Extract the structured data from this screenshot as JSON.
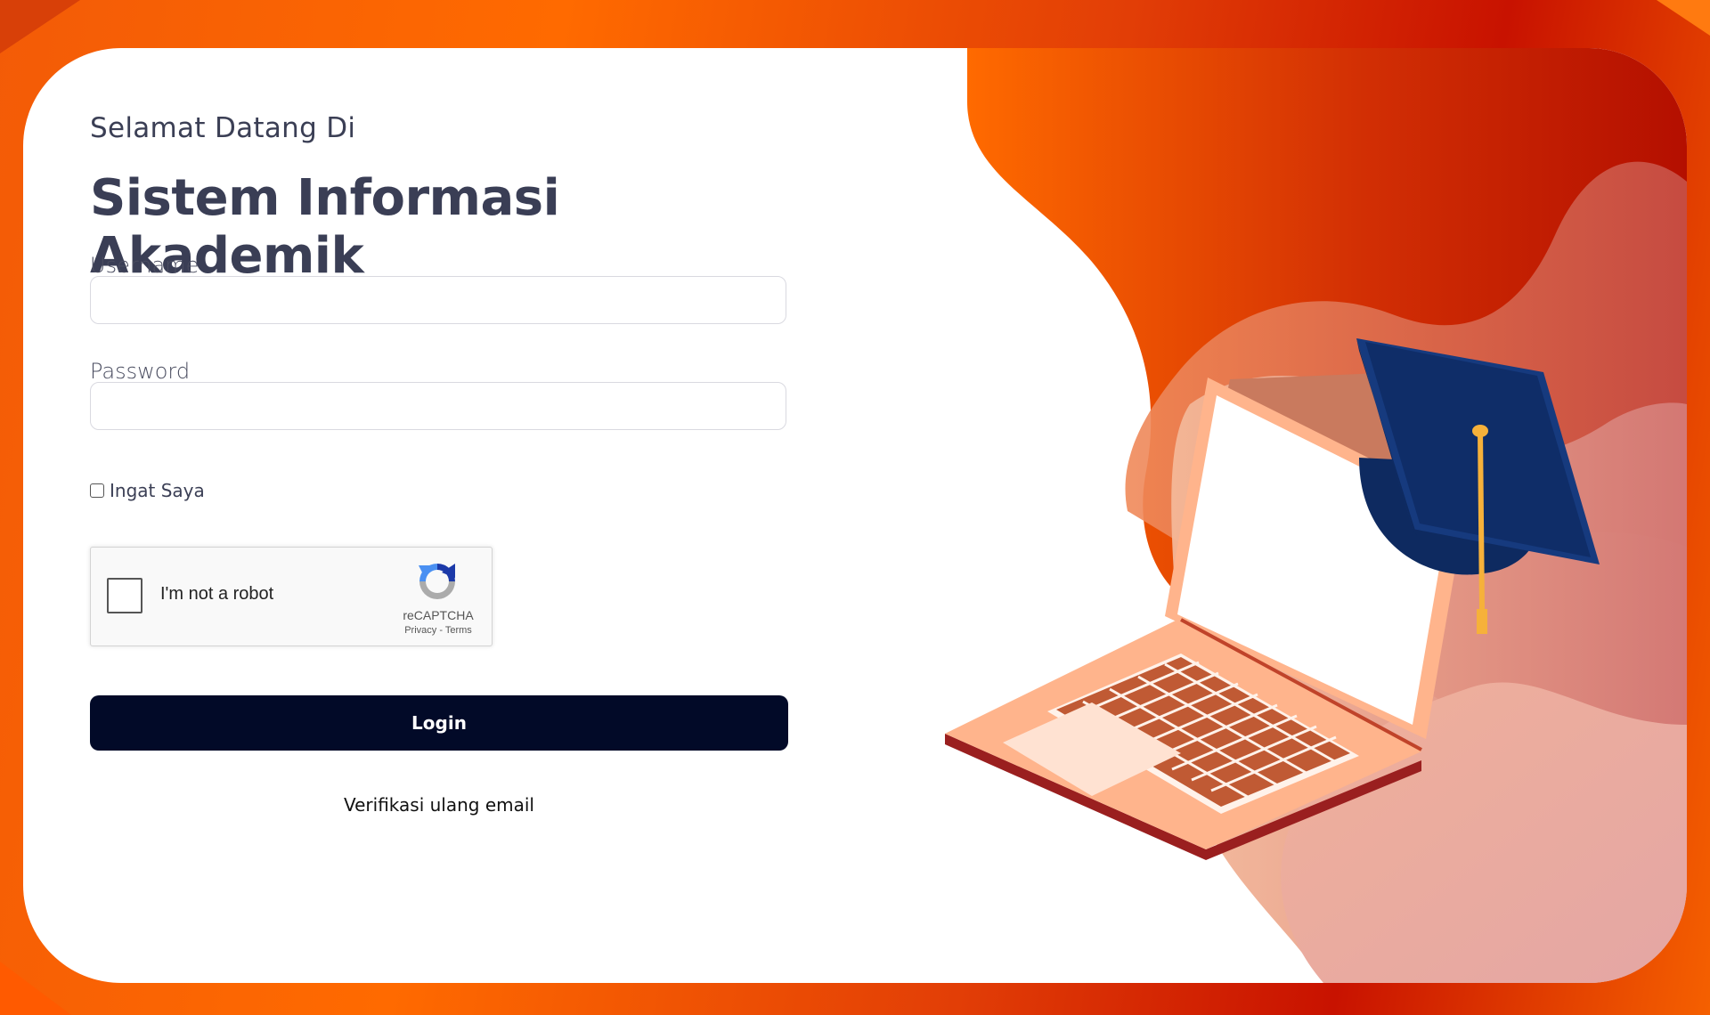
{
  "page": {
    "welcome": "Selamat Datang Di",
    "title": "Sistem Informasi Akademik"
  },
  "form": {
    "username_label": "Username",
    "username_value": "",
    "password_label": "Password",
    "password_value": "",
    "remember_label": "Ingat Saya",
    "remember_checked": false,
    "login_label": "Login",
    "reverify_label": "Verifikasi ulang email"
  },
  "recaptcha": {
    "label": "I'm not a robot",
    "brand": "reCAPTCHA",
    "links": "Privacy - Terms",
    "checked": false
  },
  "illustration": {
    "icons": [
      "laptop-icon",
      "graduation-cap-icon"
    ]
  },
  "colors": {
    "accent_orange": "#ff6a00",
    "accent_red": "#c81200",
    "button_dark": "#020a28",
    "cap_navy": "#0f2d68",
    "laptop_peach": "#ffb48c"
  }
}
